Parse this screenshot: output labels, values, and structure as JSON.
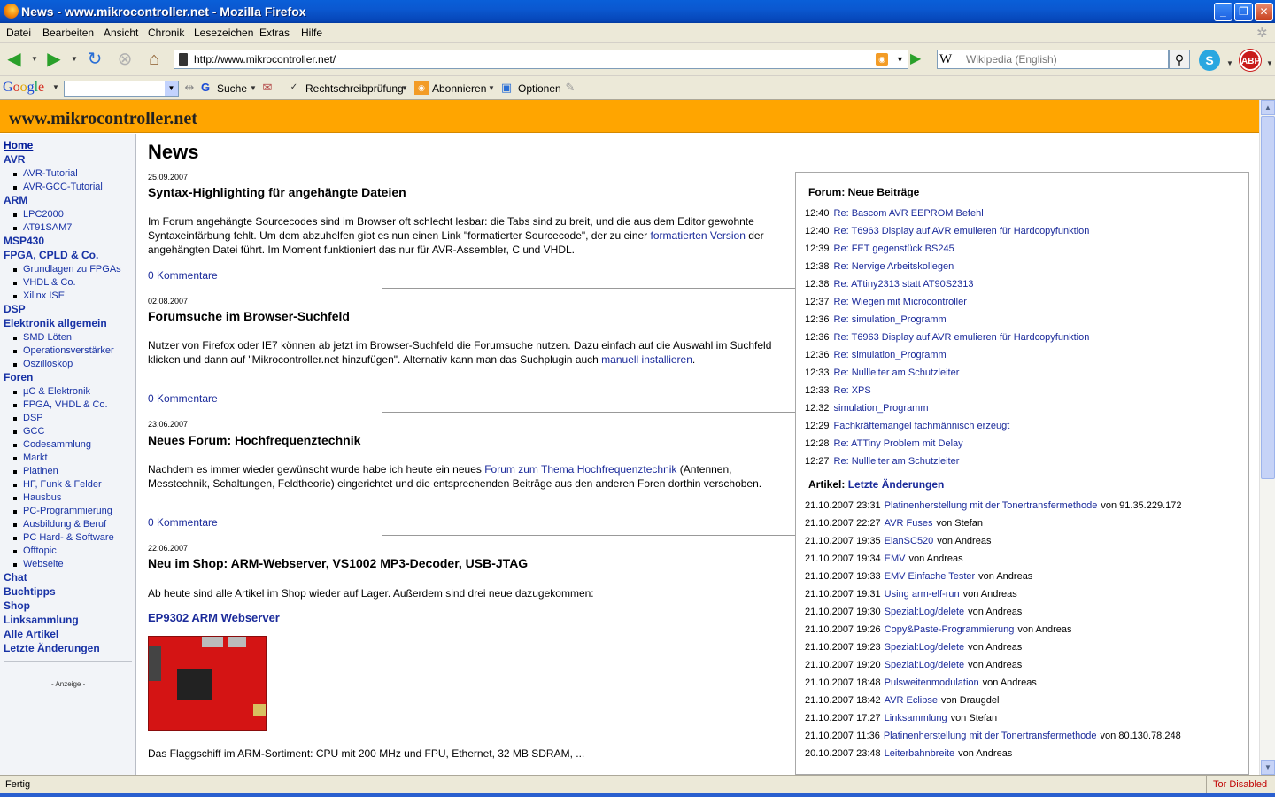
{
  "window": {
    "title": "News - www.mikrocontroller.net - Mozilla Firefox"
  },
  "menu": [
    "Datei",
    "Bearbeiten",
    "Ansicht",
    "Chronik",
    "Lesezeichen",
    "Extras",
    "Hilfe"
  ],
  "nav": {
    "url": "http://www.mikrocontroller.net/",
    "search_placeholder": "Wikipedia (English)",
    "search_engine_glyph": "W",
    "abp_label": "ABP"
  },
  "google_toolbar": {
    "search_label": "Suche",
    "spellcheck_label": "Rechtschreibprüfung",
    "subscribe_label": "Abonnieren",
    "options_label": "Optionen"
  },
  "site": {
    "title": "www.mikrocontroller.net"
  },
  "sidebar": {
    "home": "Home",
    "avr": "AVR",
    "avr_items": [
      "AVR-Tutorial",
      "AVR-GCC-Tutorial"
    ],
    "arm": "ARM",
    "arm_items": [
      "LPC2000",
      "AT91SAM7"
    ],
    "msp430": "MSP430",
    "fpga": "FPGA, CPLD & Co.",
    "fpga_items": [
      "Grundlagen zu FPGAs",
      "VHDL & Co.",
      "Xilinx ISE"
    ],
    "dsp": "DSP",
    "elektronik": "Elektronik allgemein",
    "elektronik_items": [
      "SMD Löten",
      "Operationsverstärker",
      "Oszilloskop"
    ],
    "foren": "Foren",
    "foren_items": [
      "µC & Elektronik",
      "FPGA, VHDL & Co.",
      "DSP",
      "GCC",
      "Codesammlung",
      "Markt",
      "Platinen",
      "HF, Funk & Felder",
      "Hausbus",
      "PC-Programmierung",
      "Ausbildung & Beruf",
      "PC Hard- & Software",
      "Offtopic",
      "Webseite"
    ],
    "bottom_items": [
      "Chat",
      "Buchtipps",
      "Shop",
      "Linksammlung",
      "Alle Artikel",
      "Letzte Änderungen"
    ],
    "ad_label": "- Anzeige -"
  },
  "main": {
    "heading": "News",
    "articles": [
      {
        "date": "25.09.2007",
        "title": "Syntax-Highlighting für angehängte Dateien",
        "body_1": "Im Forum angehängte Sourcecodes sind im Browser oft schlecht lesbar: die Tabs sind zu breit, und die aus dem Editor gewohnte Syntaxeinfärbung fehlt. Um dem abzuhelfen gibt es nun einen Link \"formatierter Sourcecode\", der zu einer ",
        "link_1": "formatierten Version",
        "body_2": " der angehängten Datei führt. Im Moment funktioniert das nur für AVR-Assembler, C und VHDL.",
        "comments": "0 Kommentare"
      },
      {
        "date": "02.08.2007",
        "title": "Forumsuche im Browser-Suchfeld",
        "body_1": "Nutzer von Firefox oder IE7 können ab jetzt im Browser-Suchfeld die Forumsuche nutzen. Dazu einfach auf die Auswahl im Suchfeld klicken und dann auf \"Mikrocontroller.net hinzufügen\". Alternativ kann man das Suchplugin auch ",
        "link_1": "manuell installieren",
        "body_2": ".",
        "comments": "0 Kommentare"
      },
      {
        "date": "23.06.2007",
        "title": "Neues Forum: Hochfrequenztechnik",
        "body_1": "Nachdem es immer wieder gewünscht wurde habe ich heute ein neues ",
        "link_1": "Forum zum Thema Hochfrequenztechnik",
        "body_2": " (Antennen, Messtechnik, Schaltungen, Feldtheorie) eingerichtet und die entsprechenden Beiträge aus den anderen Foren dorthin verschoben.",
        "comments": "0 Kommentare"
      },
      {
        "date": "22.06.2007",
        "title": "Neu im Shop: ARM-Webserver, VS1002 MP3-Decoder, USB-JTAG",
        "body_1": "Ab heute sind alle Artikel im Shop wieder auf Lager. Außerdem sind drei neue dazugekommen:",
        "subhead": "EP9302 ARM Webserver",
        "body_3": "Das Flaggschiff im ARM-Sortiment: CPU mit 200 MHz und FPU, Ethernet, 32 MB SDRAM, ..."
      }
    ]
  },
  "right": {
    "forum_heading": "Forum: Neue Beiträge",
    "forum_posts": [
      {
        "time": "12:40",
        "title": "Re: Bascom AVR EEPROM Befehl"
      },
      {
        "time": "12:40",
        "title": "Re: T6963 Display auf AVR emulieren für Hardcopyfunktion"
      },
      {
        "time": "12:39",
        "title": "Re: FET gegenstück BS245"
      },
      {
        "time": "12:38",
        "title": "Re: Nervige Arbeitskollegen"
      },
      {
        "time": "12:38",
        "title": "Re: ATtiny2313 statt AT90S2313"
      },
      {
        "time": "12:37",
        "title": "Re: Wiegen mit Microcontroller"
      },
      {
        "time": "12:36",
        "title": "Re: simulation_Programm"
      },
      {
        "time": "12:36",
        "title": "Re: T6963 Display auf AVR emulieren für Hardcopyfunktion"
      },
      {
        "time": "12:36",
        "title": "Re: simulation_Programm"
      },
      {
        "time": "12:33",
        "title": "Re: Nullleiter am Schutzleiter"
      },
      {
        "time": "12:33",
        "title": "Re: XPS"
      },
      {
        "time": "12:32",
        "title": "simulation_Programm"
      },
      {
        "time": "12:29",
        "title": "Fachkräftemangel fachmännisch erzeugt"
      },
      {
        "time": "12:28",
        "title": "Re: ATTiny Problem mit Delay"
      },
      {
        "time": "12:27",
        "title": "Re: Nullleiter am Schutzleiter"
      }
    ],
    "articles_heading_prefix": "Artikel: ",
    "articles_heading_link": "Letzte Änderungen",
    "article_changes": [
      {
        "time": "21.10.2007 23:31",
        "title": "Platinenherstellung mit der Tonertransfermethode",
        "by": "von 91.35.229.172"
      },
      {
        "time": "21.10.2007 22:27",
        "title": "AVR Fuses",
        "by": "von Stefan"
      },
      {
        "time": "21.10.2007 19:35",
        "title": "ElanSC520",
        "by": "von Andreas"
      },
      {
        "time": "21.10.2007 19:34",
        "title": "EMV",
        "by": "von Andreas"
      },
      {
        "time": "21.10.2007 19:33",
        "title": "EMV Einfache Tester",
        "by": "von Andreas"
      },
      {
        "time": "21.10.2007 19:31",
        "title": "Using arm-elf-run",
        "by": "von Andreas"
      },
      {
        "time": "21.10.2007 19:30",
        "title": "Spezial:Log/delete",
        "by": "von Andreas"
      },
      {
        "time": "21.10.2007 19:26",
        "title": "Copy&Paste-Programmierung",
        "by": "von Andreas"
      },
      {
        "time": "21.10.2007 19:23",
        "title": "Spezial:Log/delete",
        "by": "von Andreas"
      },
      {
        "time": "21.10.2007 19:20",
        "title": "Spezial:Log/delete",
        "by": "von Andreas"
      },
      {
        "time": "21.10.2007 18:48",
        "title": "Pulsweitenmodulation",
        "by": "von Andreas"
      },
      {
        "time": "21.10.2007 18:42",
        "title": "AVR Eclipse",
        "by": "von Draugdel"
      },
      {
        "time": "21.10.2007 17:27",
        "title": "Linksammlung",
        "by": "von Stefan"
      },
      {
        "time": "21.10.2007 11:36",
        "title": "Platinenherstellung mit der Tonertransfermethode",
        "by": "von 80.130.78.248"
      },
      {
        "time": "20.10.2007 23:48",
        "title": "Leiterbahnbreite",
        "by": "von Andreas"
      }
    ]
  },
  "status": {
    "text": "Fertig",
    "tor": "Tor Disabled"
  },
  "colors": {
    "header": "#ffa500",
    "link": "#1a2a9a",
    "sidebar_bg": "#f2f4f8"
  }
}
